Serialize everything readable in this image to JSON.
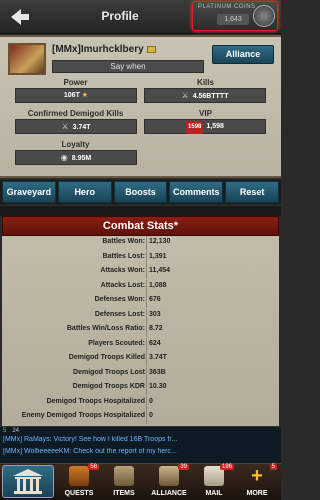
{
  "header": {
    "title": "Profile",
    "coins_label": "PLATINUM COINS",
    "coins_value": "1,643"
  },
  "profile": {
    "name": "[MMx]Imurhcklbery",
    "motto": "Say when",
    "alliance_button": "Alliance",
    "power_label": "Power",
    "power_value": "106T",
    "kills_label": "Kills",
    "kills_value": "4.56BTTTT",
    "confirmed_label": "Confirmed Demigod Kills",
    "confirmed_value": "3.74T",
    "vip_label": "VIP",
    "vip_level": "1598",
    "vip_value": "1,598",
    "loyalty_label": "Loyalty",
    "loyalty_value": "8.95M"
  },
  "tabs": [
    "Graveyard",
    "Hero",
    "Boosts",
    "Comments",
    "Reset"
  ],
  "combat": {
    "title": "Combat Stats*",
    "rows": [
      {
        "label": "Battles Won:",
        "value": "12,130"
      },
      {
        "label": "Battles Lost:",
        "value": "1,391"
      },
      {
        "label": "Attacks Won:",
        "value": "11,454"
      },
      {
        "label": "Attacks Lost:",
        "value": "1,088"
      },
      {
        "label": "Defenses Won:",
        "value": "676"
      },
      {
        "label": "Defenses Lost:",
        "value": "303"
      },
      {
        "label": "Battles Win/Loss Ratio:",
        "value": "8.72"
      },
      {
        "label": "Players Scouted:",
        "value": "624"
      },
      {
        "label": "Demigod Troops Killed",
        "value": "3.74T"
      },
      {
        "label": "Demigod Troops Lost",
        "value": "363B"
      },
      {
        "label": "Demigod Troops KDR",
        "value": "10.30"
      },
      {
        "label": "Demigod Troops Hospitalized",
        "value": "0"
      },
      {
        "label": "Enemy Demigod Troops Hospitalized",
        "value": "0"
      }
    ]
  },
  "chat": {
    "count_a": "5",
    "count_b": "24",
    "lines": [
      "[MMx] RaMays: Victory! See how I killed 16B Troops fr...",
      "[MMx] WolfieeeeeKM: Check out the report of my fierc..."
    ]
  },
  "nav": [
    {
      "label": "QUESTS",
      "badge": "58"
    },
    {
      "label": "ITEMS",
      "badge": ""
    },
    {
      "label": "ALLIANCE",
      "badge": "39"
    },
    {
      "label": "MAIL",
      "badge": "196"
    },
    {
      "label": "MORE",
      "badge": "5"
    }
  ]
}
